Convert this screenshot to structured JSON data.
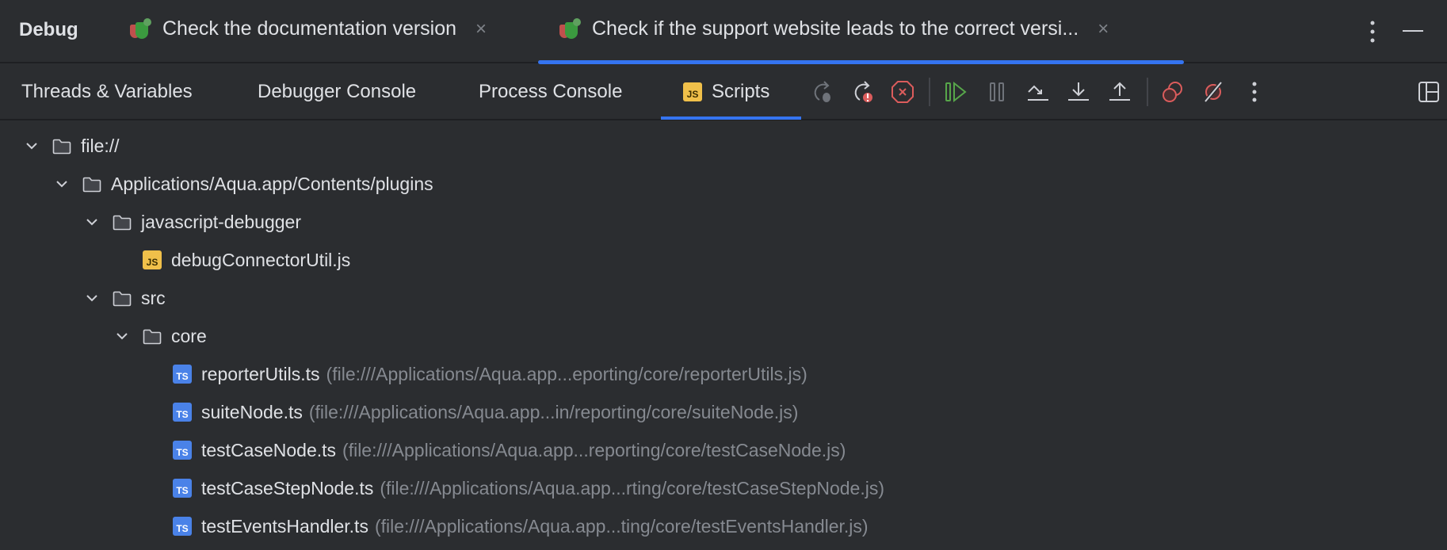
{
  "header": {
    "title": "Debug",
    "tabs": [
      {
        "label": "Check the documentation version",
        "close": "×",
        "active": false
      },
      {
        "label": "Check if the support website leads to the correct versi...",
        "close": "×",
        "active": true
      }
    ]
  },
  "debug_tabs": [
    {
      "label": "Threads & Variables"
    },
    {
      "label": "Debugger Console"
    },
    {
      "label": "Process Console"
    },
    {
      "label": "Scripts",
      "icon": "JS",
      "active": true
    }
  ],
  "colors": {
    "accent": "#3574f0",
    "green": "#57a64a",
    "red": "#db5c5c",
    "js": "#f0c04a",
    "ts": "#4a82e8"
  },
  "tree": [
    {
      "label": "file://",
      "type": "folder",
      "level": 0
    },
    {
      "label": "Applications/Aqua.app/Contents/plugins",
      "type": "folder",
      "level": 1
    },
    {
      "label": "javascript-debugger",
      "type": "folder",
      "level": 2
    },
    {
      "label": "debugConnectorUtil.js",
      "type": "js",
      "icon": "JS",
      "level": 3
    },
    {
      "label": "src",
      "type": "folder",
      "level": 2
    },
    {
      "label": "core",
      "type": "folder",
      "level": 3
    },
    {
      "label": "reporterUtils.ts",
      "path": "(file:///Applications/Aqua.app...eporting/core/reporterUtils.js)",
      "type": "ts",
      "icon": "TS",
      "level": 4
    },
    {
      "label": "suiteNode.ts",
      "path": "(file:///Applications/Aqua.app...in/reporting/core/suiteNode.js)",
      "type": "ts",
      "icon": "TS",
      "level": 4
    },
    {
      "label": "testCaseNode.ts",
      "path": "(file:///Applications/Aqua.app...reporting/core/testCaseNode.js)",
      "type": "ts",
      "icon": "TS",
      "level": 4
    },
    {
      "label": "testCaseStepNode.ts",
      "path": "(file:///Applications/Aqua.app...rting/core/testCaseStepNode.js)",
      "type": "ts",
      "icon": "TS",
      "level": 4
    },
    {
      "label": "testEventsHandler.ts",
      "path": "(file:///Applications/Aqua.app...ting/core/testEventsHandler.js)",
      "type": "ts",
      "icon": "TS",
      "level": 4
    }
  ]
}
